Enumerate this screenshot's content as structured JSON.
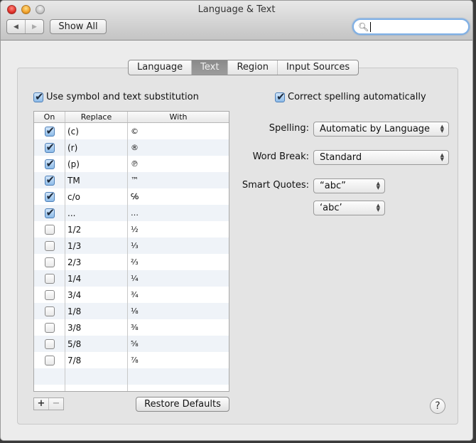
{
  "window": {
    "title": "Language & Text"
  },
  "toolbar": {
    "back_icon": "◀",
    "forward_icon": "▶",
    "show_all_label": "Show All",
    "search": {
      "value": "",
      "placeholder": "",
      "icon": "🔍"
    }
  },
  "tabs": [
    {
      "label": "Language",
      "active": false
    },
    {
      "label": "Text",
      "active": true
    },
    {
      "label": "Region",
      "active": false
    },
    {
      "label": "Input Sources",
      "active": false
    }
  ],
  "substitution": {
    "label": "Use symbol and text substitution",
    "checked": true,
    "columns": {
      "on": "On",
      "replace": "Replace",
      "with": "With"
    },
    "rows": [
      {
        "on": true,
        "replace": "(c)",
        "with": "©"
      },
      {
        "on": true,
        "replace": "(r)",
        "with": "®"
      },
      {
        "on": true,
        "replace": "(p)",
        "with": "℗"
      },
      {
        "on": true,
        "replace": "TM",
        "with": "™"
      },
      {
        "on": true,
        "replace": "c/o",
        "with": "℅"
      },
      {
        "on": true,
        "replace": "...",
        "with": "…"
      },
      {
        "on": false,
        "replace": "1/2",
        "with": "½"
      },
      {
        "on": false,
        "replace": "1/3",
        "with": "⅓"
      },
      {
        "on": false,
        "replace": "2/3",
        "with": "⅔"
      },
      {
        "on": false,
        "replace": "1/4",
        "with": "¼"
      },
      {
        "on": false,
        "replace": "3/4",
        "with": "¾"
      },
      {
        "on": false,
        "replace": "1/8",
        "with": "⅛"
      },
      {
        "on": false,
        "replace": "3/8",
        "with": "⅜"
      },
      {
        "on": false,
        "replace": "5/8",
        "with": "⅝"
      },
      {
        "on": false,
        "replace": "7/8",
        "with": "⅞"
      }
    ],
    "add_label": "+",
    "remove_label": "−",
    "restore_label": "Restore Defaults"
  },
  "spelling": {
    "correct_label": "Correct spelling automatically",
    "correct_checked": true,
    "spelling_label": "Spelling:",
    "spelling_value": "Automatic by Language",
    "word_break_label": "Word Break:",
    "word_break_value": "Standard",
    "smart_quotes_label": "Smart Quotes:",
    "double_quotes_value": "“abc”",
    "single_quotes_value": "‘abc’"
  },
  "help_label": "?"
}
